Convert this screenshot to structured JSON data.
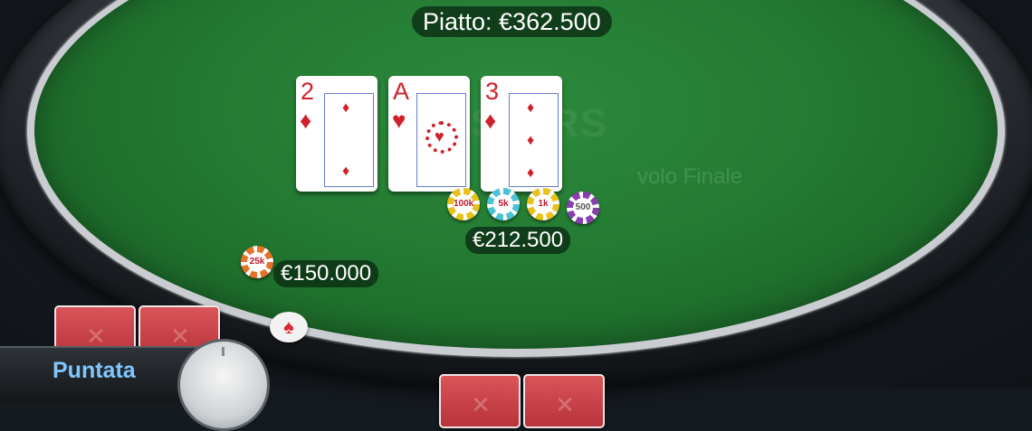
{
  "table": {
    "watermark_logo": "STARS",
    "watermark_sub": "volo Finale"
  },
  "pot": {
    "label": "Piatto: €362.500"
  },
  "board": [
    {
      "rank": "2",
      "suit": "♦"
    },
    {
      "rank": "A",
      "suit": "♥"
    },
    {
      "rank": "3",
      "suit": "♦"
    }
  ],
  "bets": {
    "center": {
      "amount": "€212.500",
      "chips": [
        {
          "label": "100k",
          "color": "#e8c21a"
        },
        {
          "label": "5k",
          "color": "#4cc2d6"
        },
        {
          "label": "1k",
          "color": "#e8c21a"
        },
        {
          "label": "500",
          "color": "#8a3fb0"
        }
      ]
    },
    "left": {
      "amount": "€150.000",
      "chips": [
        {
          "label": "25k",
          "color": "#e5732a"
        }
      ]
    }
  },
  "dealer_button": {
    "symbol": "♠"
  },
  "player": {
    "name": "Puntata"
  },
  "colors": {
    "felt": "#237a32",
    "card_red": "#d0202a",
    "name_blue": "#7fc7ff"
  }
}
